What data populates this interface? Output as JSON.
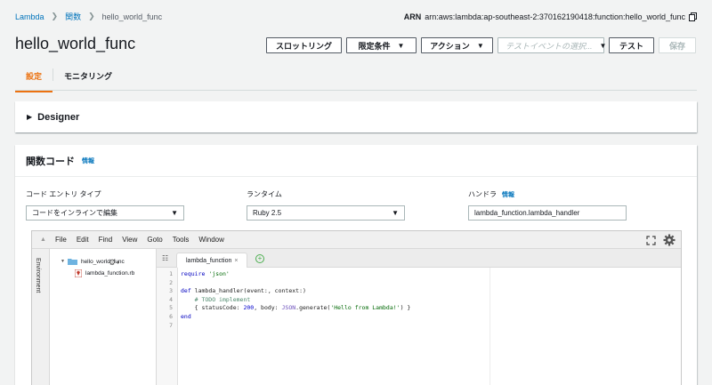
{
  "breadcrumb": {
    "items": [
      "Lambda",
      "関数",
      "hello_world_func"
    ]
  },
  "arn": {
    "label": "ARN",
    "value": "arn:aws:lambda:ap-southeast-2:370162190418:function:hello_world_func"
  },
  "page_title": "hello_world_func",
  "toolbar": {
    "throttle_label": "スロットリング",
    "qualifiers_label": "限定条件",
    "actions_label": "アクション",
    "test_event_placeholder": "テストイベントの選択...",
    "test_label": "テスト",
    "save_label": "保存"
  },
  "tabs": [
    {
      "label": "設定",
      "active": true
    },
    {
      "label": "モニタリング",
      "active": false
    }
  ],
  "designer": {
    "label": "Designer"
  },
  "function_code": {
    "title": "関数コード",
    "info_label": "情報",
    "entry_type_label": "コード エントリ タイプ",
    "entry_type_value": "コードをインラインで編集",
    "runtime_label": "ランタイム",
    "runtime_value": "Ruby 2.5",
    "handler_label": "ハンドラ",
    "handler_info": "情報",
    "handler_value": "lambda_function.lambda_handler"
  },
  "ide": {
    "menu": [
      "File",
      "Edit",
      "Find",
      "View",
      "Goto",
      "Tools",
      "Window"
    ],
    "environment_label": "Environment",
    "tree": {
      "folder": "hello_world_func",
      "file": "lambda_function.rb"
    },
    "open_tab": "lambda_function",
    "line_numbers": [
      "1",
      "2",
      "3",
      "4",
      "5",
      "6",
      "7"
    ]
  },
  "colors": {
    "accent": "#ec7211",
    "link": "#0073bb",
    "background": "#f2f3f3"
  }
}
